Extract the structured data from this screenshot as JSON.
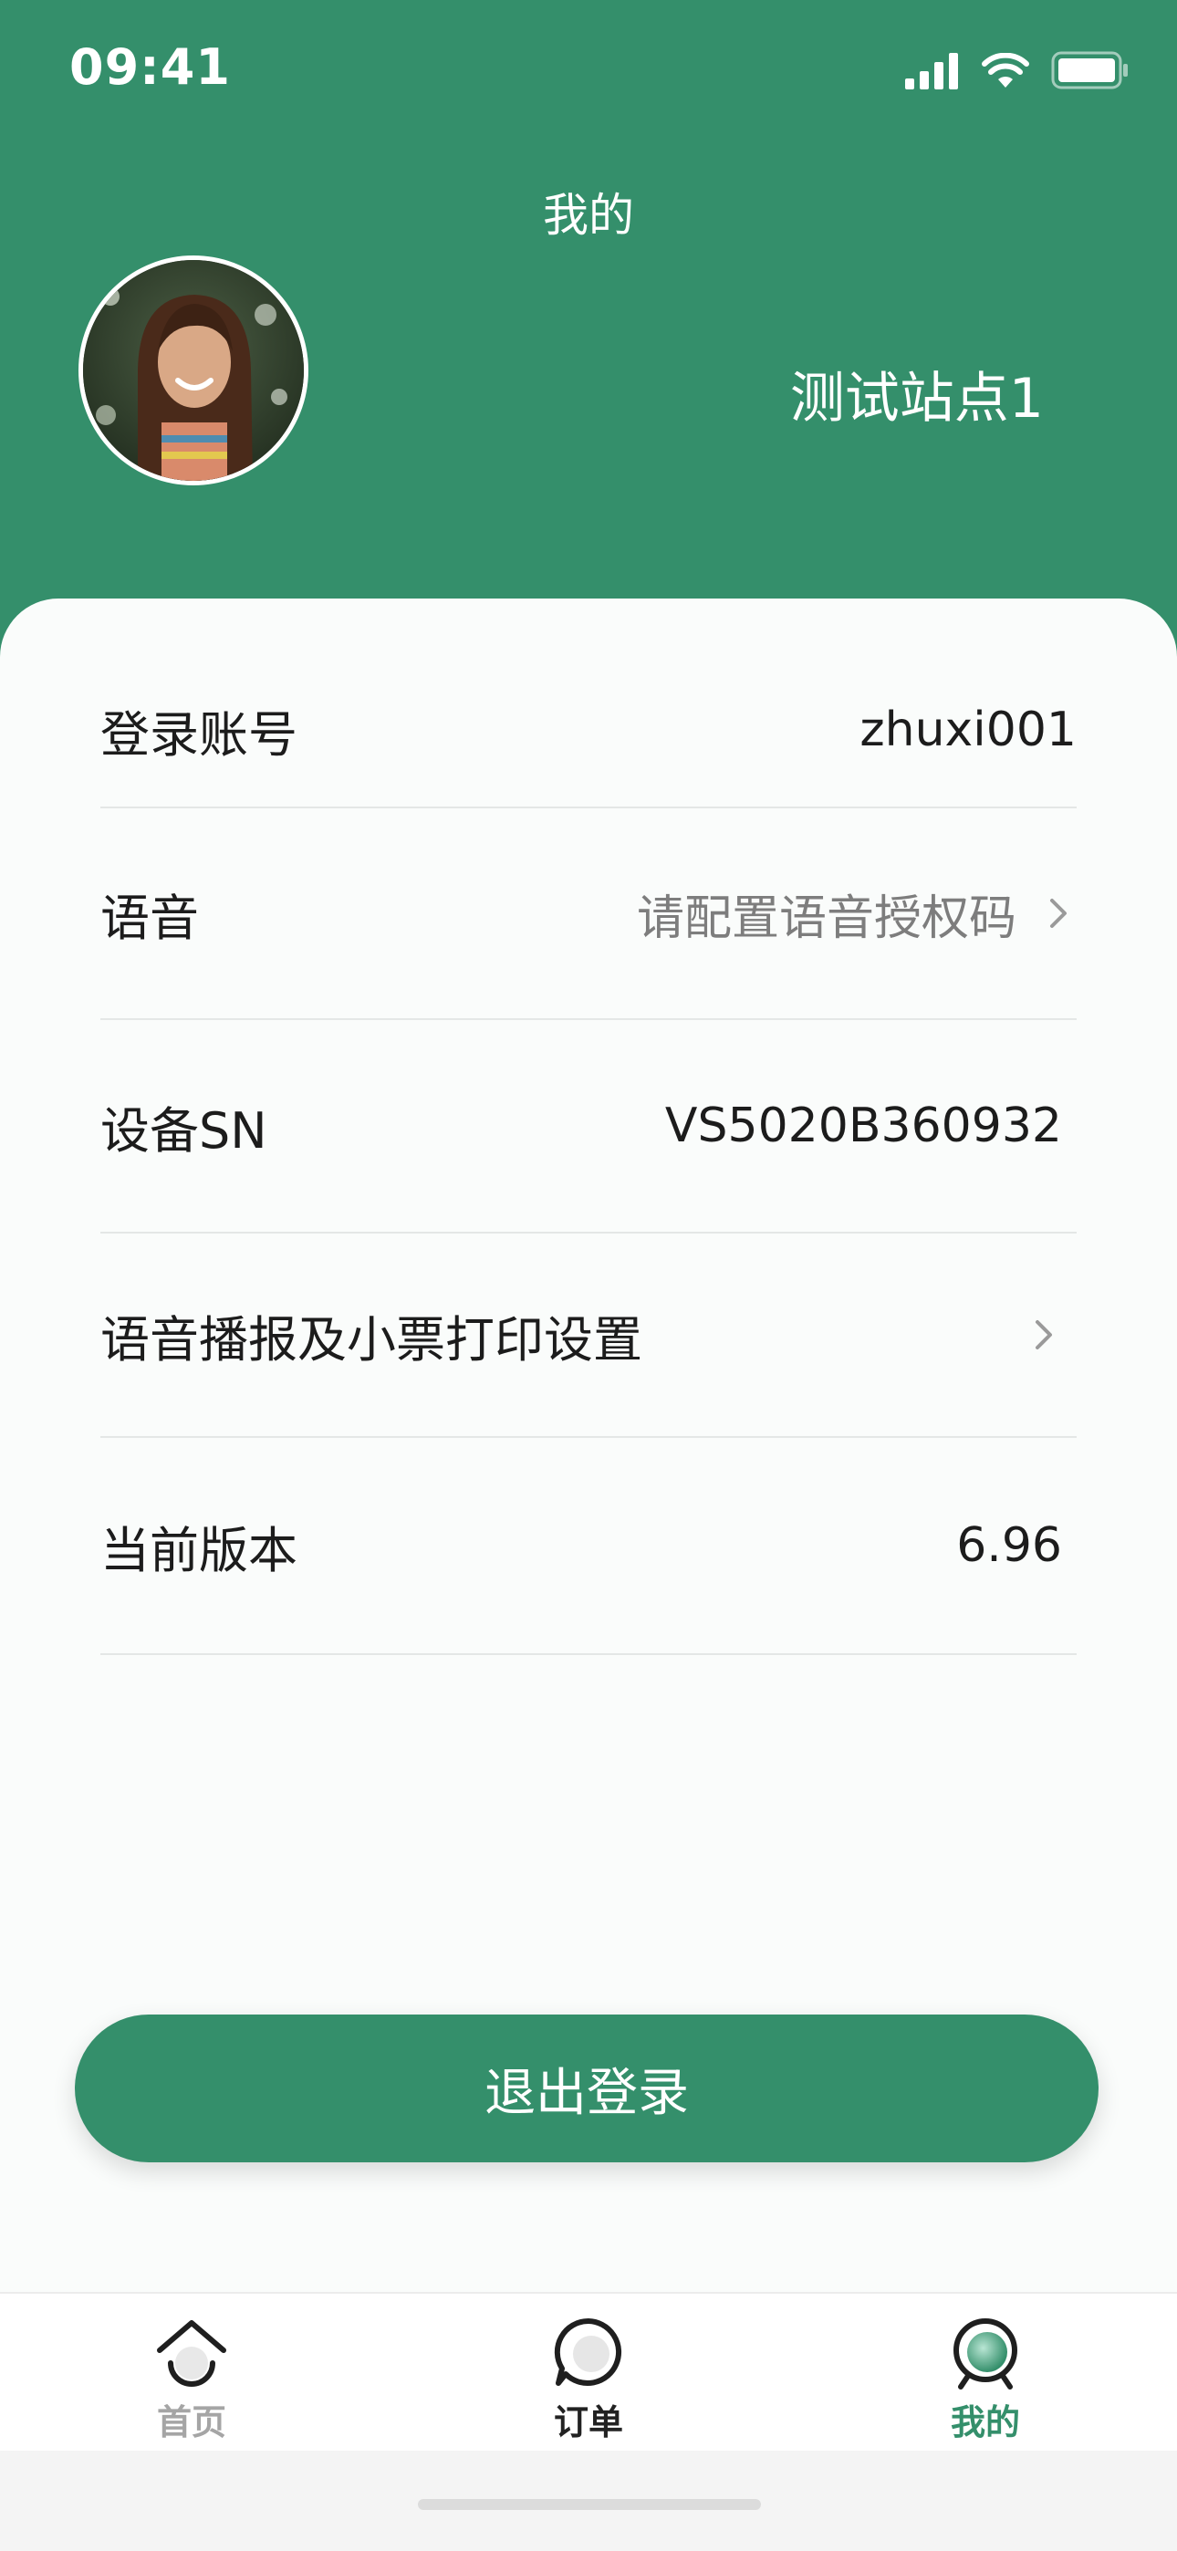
{
  "status_bar": {
    "time": "09:41"
  },
  "header": {
    "title": "我的",
    "station_name": "测试站点1"
  },
  "profile_rows": [
    {
      "label": "登录账号",
      "value": "zhuxi001",
      "chevron": false
    },
    {
      "label": "语音",
      "value": "请配置语音授权码",
      "chevron": true
    },
    {
      "label": "设备SN",
      "value": "VS5020B360932",
      "chevron": false
    },
    {
      "label": "语音播报及小票打印设置",
      "value": "",
      "chevron": true
    },
    {
      "label": "当前版本",
      "value": "6.96",
      "chevron": false
    }
  ],
  "logout_label": "退出登录",
  "tabs": [
    {
      "label": "首页",
      "icon": "home-icon",
      "state": "inactive"
    },
    {
      "label": "订单",
      "icon": "chat-icon",
      "state": "dark"
    },
    {
      "label": "我的",
      "icon": "profile-icon",
      "state": "active"
    }
  ],
  "colors": {
    "brand_green": "#348f6b",
    "inactive_tab": "#a5a5a5"
  }
}
